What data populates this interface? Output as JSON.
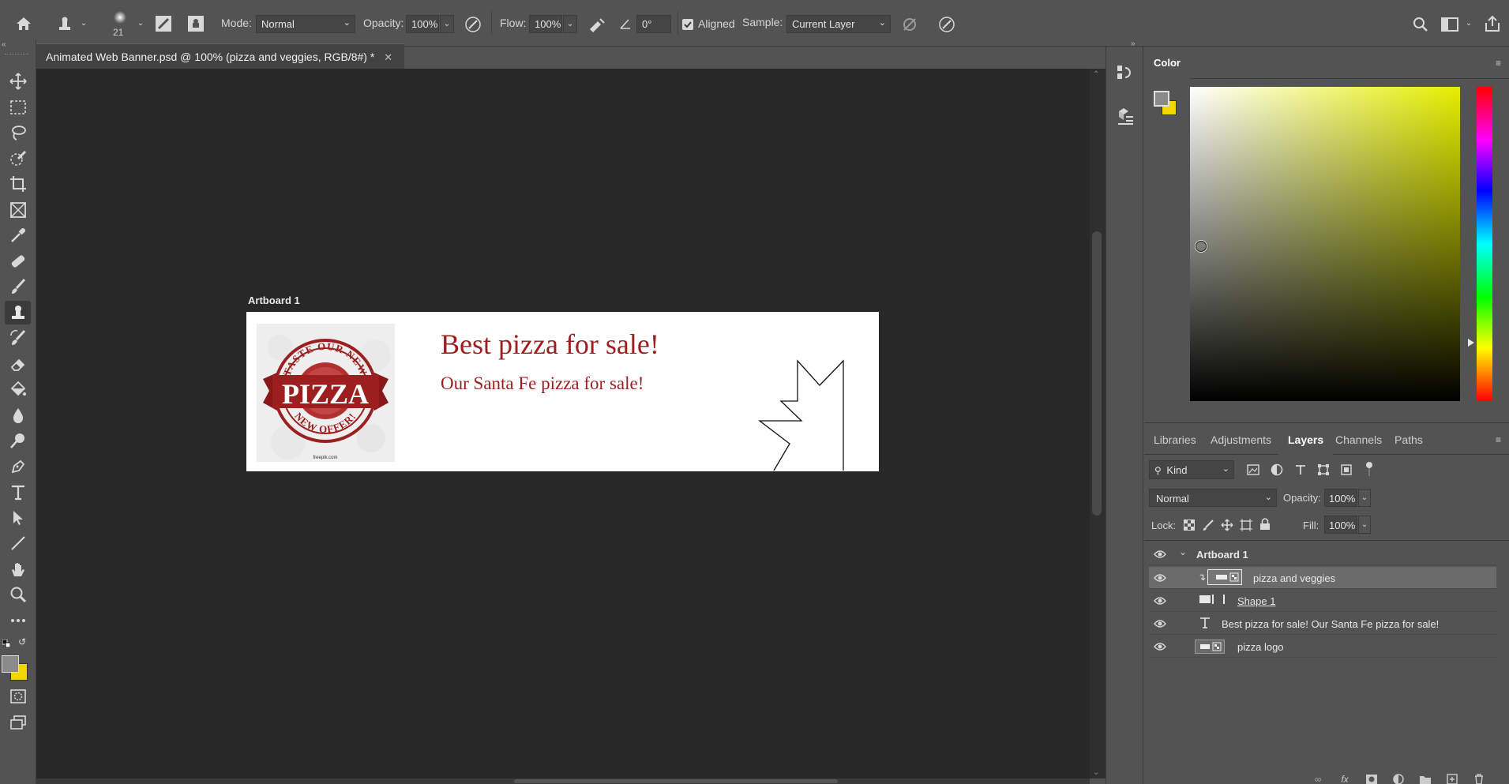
{
  "options_bar": {
    "brush_size": "21",
    "mode_label": "Mode:",
    "mode_value": "Normal",
    "opacity_label": "Opacity:",
    "opacity_value": "100%",
    "flow_label": "Flow:",
    "flow_value": "100%",
    "angle_value": "0°",
    "aligned_label": "Aligned",
    "aligned_checked": true,
    "sample_label": "Sample:",
    "sample_value": "Current Layer"
  },
  "document": {
    "tab_title": "Animated Web Banner.psd @ 100% (pizza and veggies, RGB/8#) *",
    "artboard_label": "Artboard 1",
    "headline": "Best pizza for sale!",
    "subline": "Our Santa Fe pizza for sale!",
    "logo": {
      "top_arc": "TASTE OUR NEW",
      "banner": "PIZZA",
      "bottom_arc": "NEW OFFER!",
      "credit": "freepik.com"
    }
  },
  "color_panel": {
    "tab": "Color",
    "foreground": "#8a8a8a",
    "background": "#f2d600",
    "hue": "#e6ee00"
  },
  "layers_panel": {
    "tabs": [
      "Libraries",
      "Adjustments",
      "Layers",
      "Channels",
      "Paths"
    ],
    "active_tab": "Layers",
    "filter_label": "Kind",
    "blend_mode": "Normal",
    "opacity_label": "Opacity:",
    "opacity_value": "100%",
    "lock_label": "Lock:",
    "fill_label": "Fill:",
    "fill_value": "100%",
    "layers": [
      {
        "name": "Artboard 1",
        "type": "artboard"
      },
      {
        "name": "pizza and veggies",
        "type": "smart",
        "selected": true
      },
      {
        "name": "Shape 1",
        "type": "shape"
      },
      {
        "name": "Best pizza for sale! Our Santa Fe pizza for sale!",
        "type": "text"
      },
      {
        "name": "pizza logo",
        "type": "smart"
      }
    ]
  },
  "colors": {
    "accent_red": "#9c1e1e",
    "panel_bg": "#535353",
    "canvas_bg": "#282828"
  }
}
